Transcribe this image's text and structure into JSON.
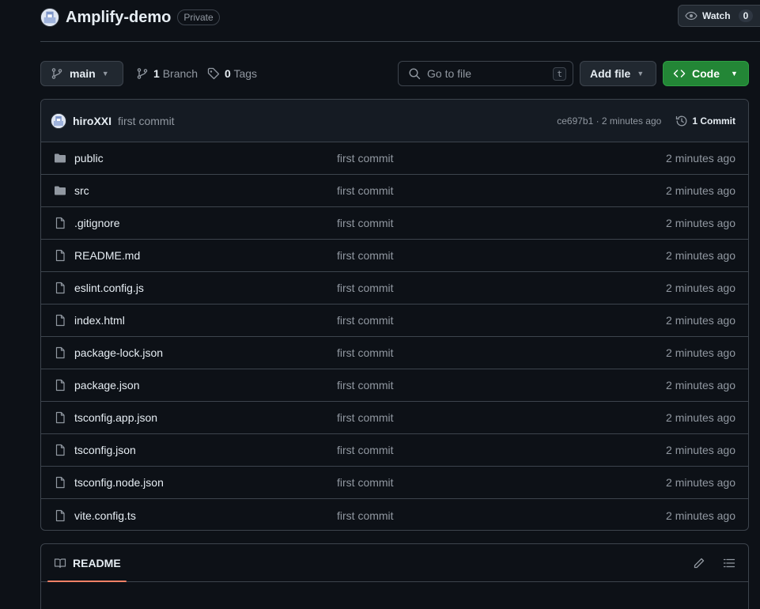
{
  "repo": {
    "name": "Amplify-demo",
    "visibility": "Private",
    "watch_label": "Watch",
    "watch_count": "0"
  },
  "toolbar": {
    "branch": "main",
    "branch_count": "1",
    "branch_label": "Branch",
    "tag_count": "0",
    "tag_label": "Tags",
    "search_placeholder": "Go to file",
    "search_shortcut": "t",
    "add_file_label": "Add file",
    "code_label": "Code"
  },
  "latest_commit": {
    "author": "hiroXXI",
    "message": "first commit",
    "sha_time": "ce697b1 · 2 minutes ago",
    "commit_count_label": "1 Commit"
  },
  "files": [
    {
      "name": "public",
      "type": "folder",
      "message": "first commit",
      "time": "2 minutes ago"
    },
    {
      "name": "src",
      "type": "folder",
      "message": "first commit",
      "time": "2 minutes ago"
    },
    {
      "name": ".gitignore",
      "type": "file",
      "message": "first commit",
      "time": "2 minutes ago"
    },
    {
      "name": "README.md",
      "type": "file",
      "message": "first commit",
      "time": "2 minutes ago"
    },
    {
      "name": "eslint.config.js",
      "type": "file",
      "message": "first commit",
      "time": "2 minutes ago"
    },
    {
      "name": "index.html",
      "type": "file",
      "message": "first commit",
      "time": "2 minutes ago"
    },
    {
      "name": "package-lock.json",
      "type": "file",
      "message": "first commit",
      "time": "2 minutes ago"
    },
    {
      "name": "package.json",
      "type": "file",
      "message": "first commit",
      "time": "2 minutes ago"
    },
    {
      "name": "tsconfig.app.json",
      "type": "file",
      "message": "first commit",
      "time": "2 minutes ago"
    },
    {
      "name": "tsconfig.json",
      "type": "file",
      "message": "first commit",
      "time": "2 minutes ago"
    },
    {
      "name": "tsconfig.node.json",
      "type": "file",
      "message": "first commit",
      "time": "2 minutes ago"
    },
    {
      "name": "vite.config.ts",
      "type": "file",
      "message": "first commit",
      "time": "2 minutes ago"
    }
  ],
  "readme": {
    "title": "README"
  },
  "colors": {
    "background": "#0d1117",
    "border": "#3d444d",
    "code_button": "#238636",
    "muted_text": "#9198a1",
    "readme_underline": "#f78166"
  }
}
